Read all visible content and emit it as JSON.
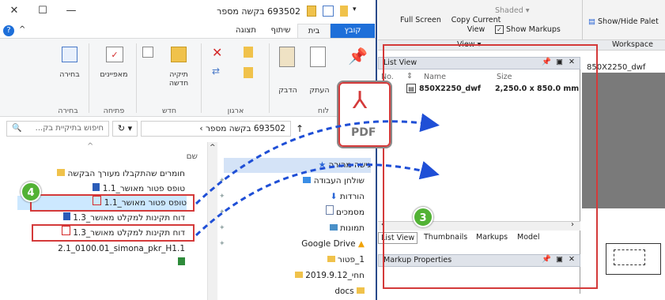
{
  "explorer": {
    "window_title": "693502 בקשה מספר",
    "tabs": [
      "קובץ",
      "בית",
      "שיתוף",
      "תצוגה"
    ],
    "ribbon": {
      "groups": {
        "clipboard": "לוח",
        "organize": "ארגון",
        "new": "חדש",
        "open": "פתיחה",
        "select": "בחירה"
      },
      "buttons": {
        "pin": "הצמד לגישה מהירה",
        "copy": "העתק",
        "paste": "הדבק",
        "new_folder": "תיקיה חדשה",
        "properties": "מאפיינים",
        "select": "בחירה"
      }
    },
    "address": {
      "path_folder": "693502 בקשה מספר",
      "search_placeholder": "חיפוש בתיקיית בק..."
    },
    "file_list": {
      "column_name": "שם",
      "items": [
        "חומרים שהתקבלו מעורך הבקשה",
        "טופס פטור מאושר_1.1",
        "טופס פטור מאושר_1.1",
        "דוח תקינות למקלט מאושר_1.3",
        "דוח תקינות למקלט מאושר_1.3",
        "2.1_0100.01_simona_pkr_H1.1"
      ]
    },
    "nav_pane": {
      "items": [
        "גישה מהירה",
        "שולחן העבודה",
        "הורדות",
        "מסמכים",
        "תמונות",
        "Google Drive",
        "1_פטור",
        "חחי_2019.9.12",
        "docs"
      ]
    }
  },
  "viewer": {
    "toolbar": {
      "full_screen": "Full Screen",
      "copy_current_view": "Copy Current View",
      "shaded": "Shaded",
      "show_markups": "Show Markups",
      "show_hide_palettes": "Show/Hide Palet",
      "view_group": "View",
      "workspace_group": "Workspace"
    },
    "list_view": {
      "title": "List View",
      "columns": [
        "No.",
        "Name",
        "Size"
      ],
      "rows": [
        {
          "no": "1",
          "name": "850X2250_dwf",
          "size": "2,250.0 x 850.0 mm"
        }
      ],
      "tabs": [
        "List View",
        "Thumbnails",
        "Markups",
        "Model"
      ]
    },
    "markup_properties": "Markup Properties",
    "pdf_label": "PDF",
    "document_tab": "850X2250_dwf"
  },
  "annotations": {
    "badge_left": "4",
    "badge_mid": "3"
  },
  "colors": {
    "highlight_red": "#d43a3a",
    "arrow_blue": "#1f4fd6",
    "badge_green": "#52b235",
    "selection_blue": "#cce8ff"
  }
}
